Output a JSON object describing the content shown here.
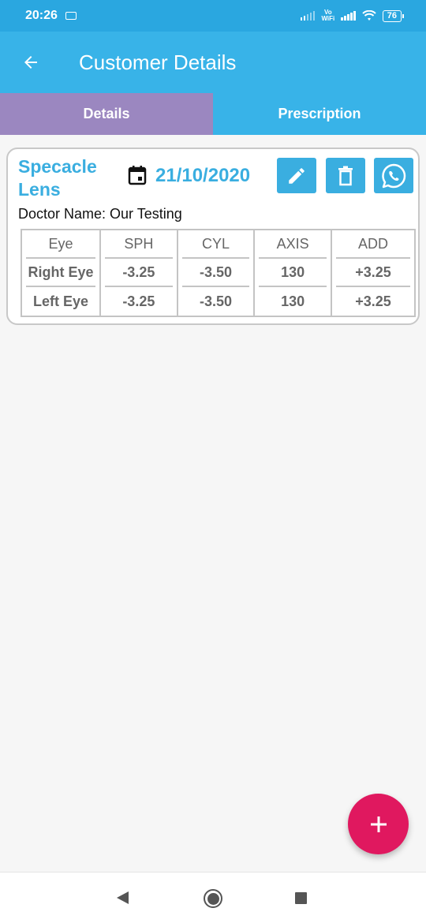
{
  "status_bar": {
    "time": "20:26",
    "vowifi_top": "Vo",
    "vowifi_bottom": "WiFi",
    "battery": "76"
  },
  "app_bar": {
    "title": "Customer Details",
    "back_icon": "arrow-left-icon"
  },
  "tabs": [
    {
      "label": "Details",
      "active": true
    },
    {
      "label": "Prescription",
      "active": false
    }
  ],
  "colors": {
    "primary": "#38b3e8",
    "status_bar": "#2aa7e0",
    "active_tab": "#9b87c0",
    "accent_text": "#3aaee0",
    "fab": "#e0185f"
  },
  "record": {
    "title": "Specacle Lens",
    "date": "21/10/2020",
    "doctor": "Doctor Name: Our Testing",
    "actions": [
      "edit-icon",
      "delete-icon",
      "whatsapp-icon"
    ],
    "table": {
      "headers": [
        "Eye",
        "SPH",
        "CYL",
        "AXIS",
        "ADD"
      ],
      "rows": [
        [
          "Right Eye",
          "-3.25",
          "-3.50",
          "130",
          "+3.25"
        ],
        [
          "Left Eye",
          "-3.25",
          "-3.50",
          "130",
          "+3.25"
        ]
      ]
    }
  },
  "fab": {
    "icon": "plus-icon",
    "label": "+"
  }
}
